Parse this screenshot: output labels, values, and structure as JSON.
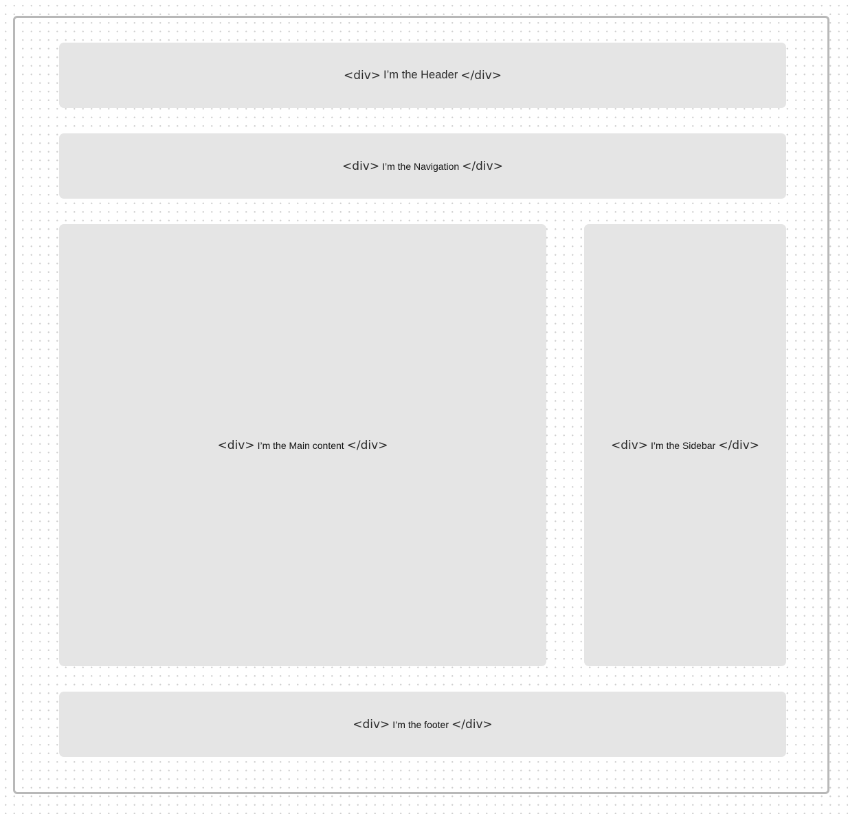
{
  "open_tag": "<div>",
  "close_tag": "</div>",
  "header": {
    "label": "I’m the Header"
  },
  "navigation": {
    "label": "I’m the Navigation"
  },
  "main": {
    "label": "I’m the Main content"
  },
  "sidebar": {
    "label": "I’m the Sidebar"
  },
  "footer": {
    "label": "I’m the footer"
  },
  "colors": {
    "box_fill": "#e5e5e5",
    "frame_border": "#b8b8b8",
    "grid_dots": "#cfcfcf"
  }
}
